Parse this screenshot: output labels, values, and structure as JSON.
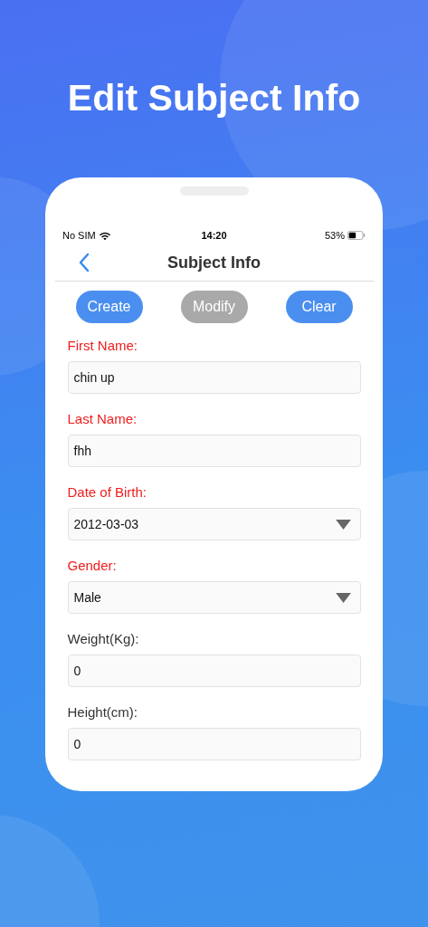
{
  "headline": "Edit Subject Info",
  "status_bar": {
    "carrier": "No SIM",
    "time": "14:20",
    "battery": "53%"
  },
  "nav": {
    "title": "Subject Info"
  },
  "buttons": [
    {
      "label": "Create",
      "disabled": false
    },
    {
      "label": "Modify",
      "disabled": true
    },
    {
      "label": "Clear",
      "disabled": false
    }
  ],
  "fields": [
    {
      "label": "First Name:",
      "required": true,
      "kind": "text",
      "value": "chin up"
    },
    {
      "label": "Last Name:",
      "required": true,
      "kind": "text",
      "value": "fhh"
    },
    {
      "label": "Date of Birth:",
      "required": true,
      "kind": "select",
      "value": "2012-03-03"
    },
    {
      "label": "Gender:",
      "required": true,
      "kind": "select",
      "value": "Male"
    },
    {
      "label": "Weight(Kg):",
      "required": false,
      "kind": "text",
      "value": "0"
    },
    {
      "label": "Height(cm):",
      "required": false,
      "kind": "text",
      "value": "0"
    }
  ]
}
